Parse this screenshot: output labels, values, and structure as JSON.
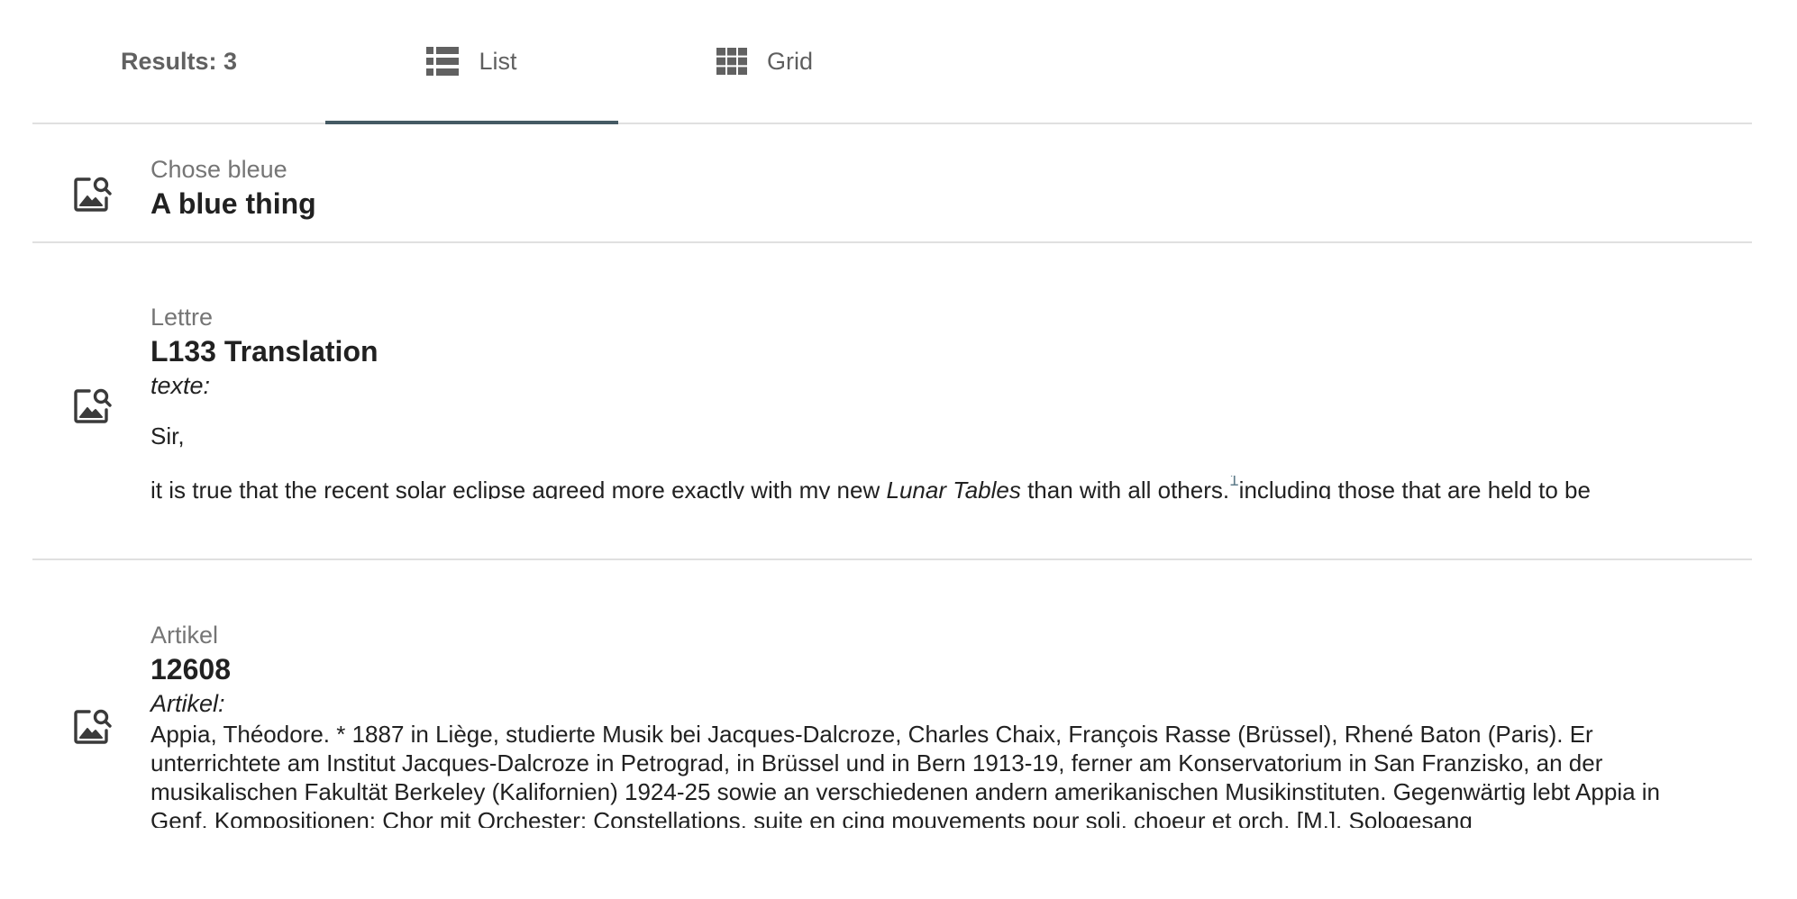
{
  "tabs": {
    "results_label": "Results: 3",
    "list_label": "List",
    "grid_label": "Grid"
  },
  "results": [
    {
      "kind": "Chose bleue",
      "title": "A blue thing"
    },
    {
      "kind": "Lettre",
      "title": "L133 Translation",
      "field_label": "texte:",
      "salutation": "Sir,",
      "text_before": "it is true that the recent solar eclipse agreed more exactly with my new ",
      "text_italic": "Lunar Tables",
      "text_middle": " than with all others.",
      "footnote": "1",
      "text_after": "including those that are held to be"
    },
    {
      "kind": "Artikel",
      "title": "12608",
      "field_label": "Artikel:",
      "text": "Appia, Théodore. * 1887 in Liège, studierte Musik bei Jacques-Dalcroze, Charles Chaix, François Rasse (Brüssel), Rhené Baton (Paris). Er unterrichtete am Institut Jacques-Dalcroze in Petrograd, in Brüssel und in Bern 1913-19, ferner am Konservatorium in San Franzisko, an der musikalischen Fakultät Berkeley (Kalifornien) 1924-25 sowie an verschiedenen andern amerikanischen Musikinstituten. Gegenwärtig lebt Appia in Genf. Kompositionen: Chor mit Orchester: Constellations, suite en cinq mouvements pour soli, choeur et orch. [M.]. Sologesang"
    }
  ],
  "icons": {
    "tab_list": "list-icon",
    "tab_grid": "grid-icon",
    "result": "image-search-icon"
  },
  "colors": {
    "tab_indicator": "#455a64",
    "divider": "#e0e0e0",
    "kind_text": "#757575",
    "footnote": "#607d8b"
  }
}
